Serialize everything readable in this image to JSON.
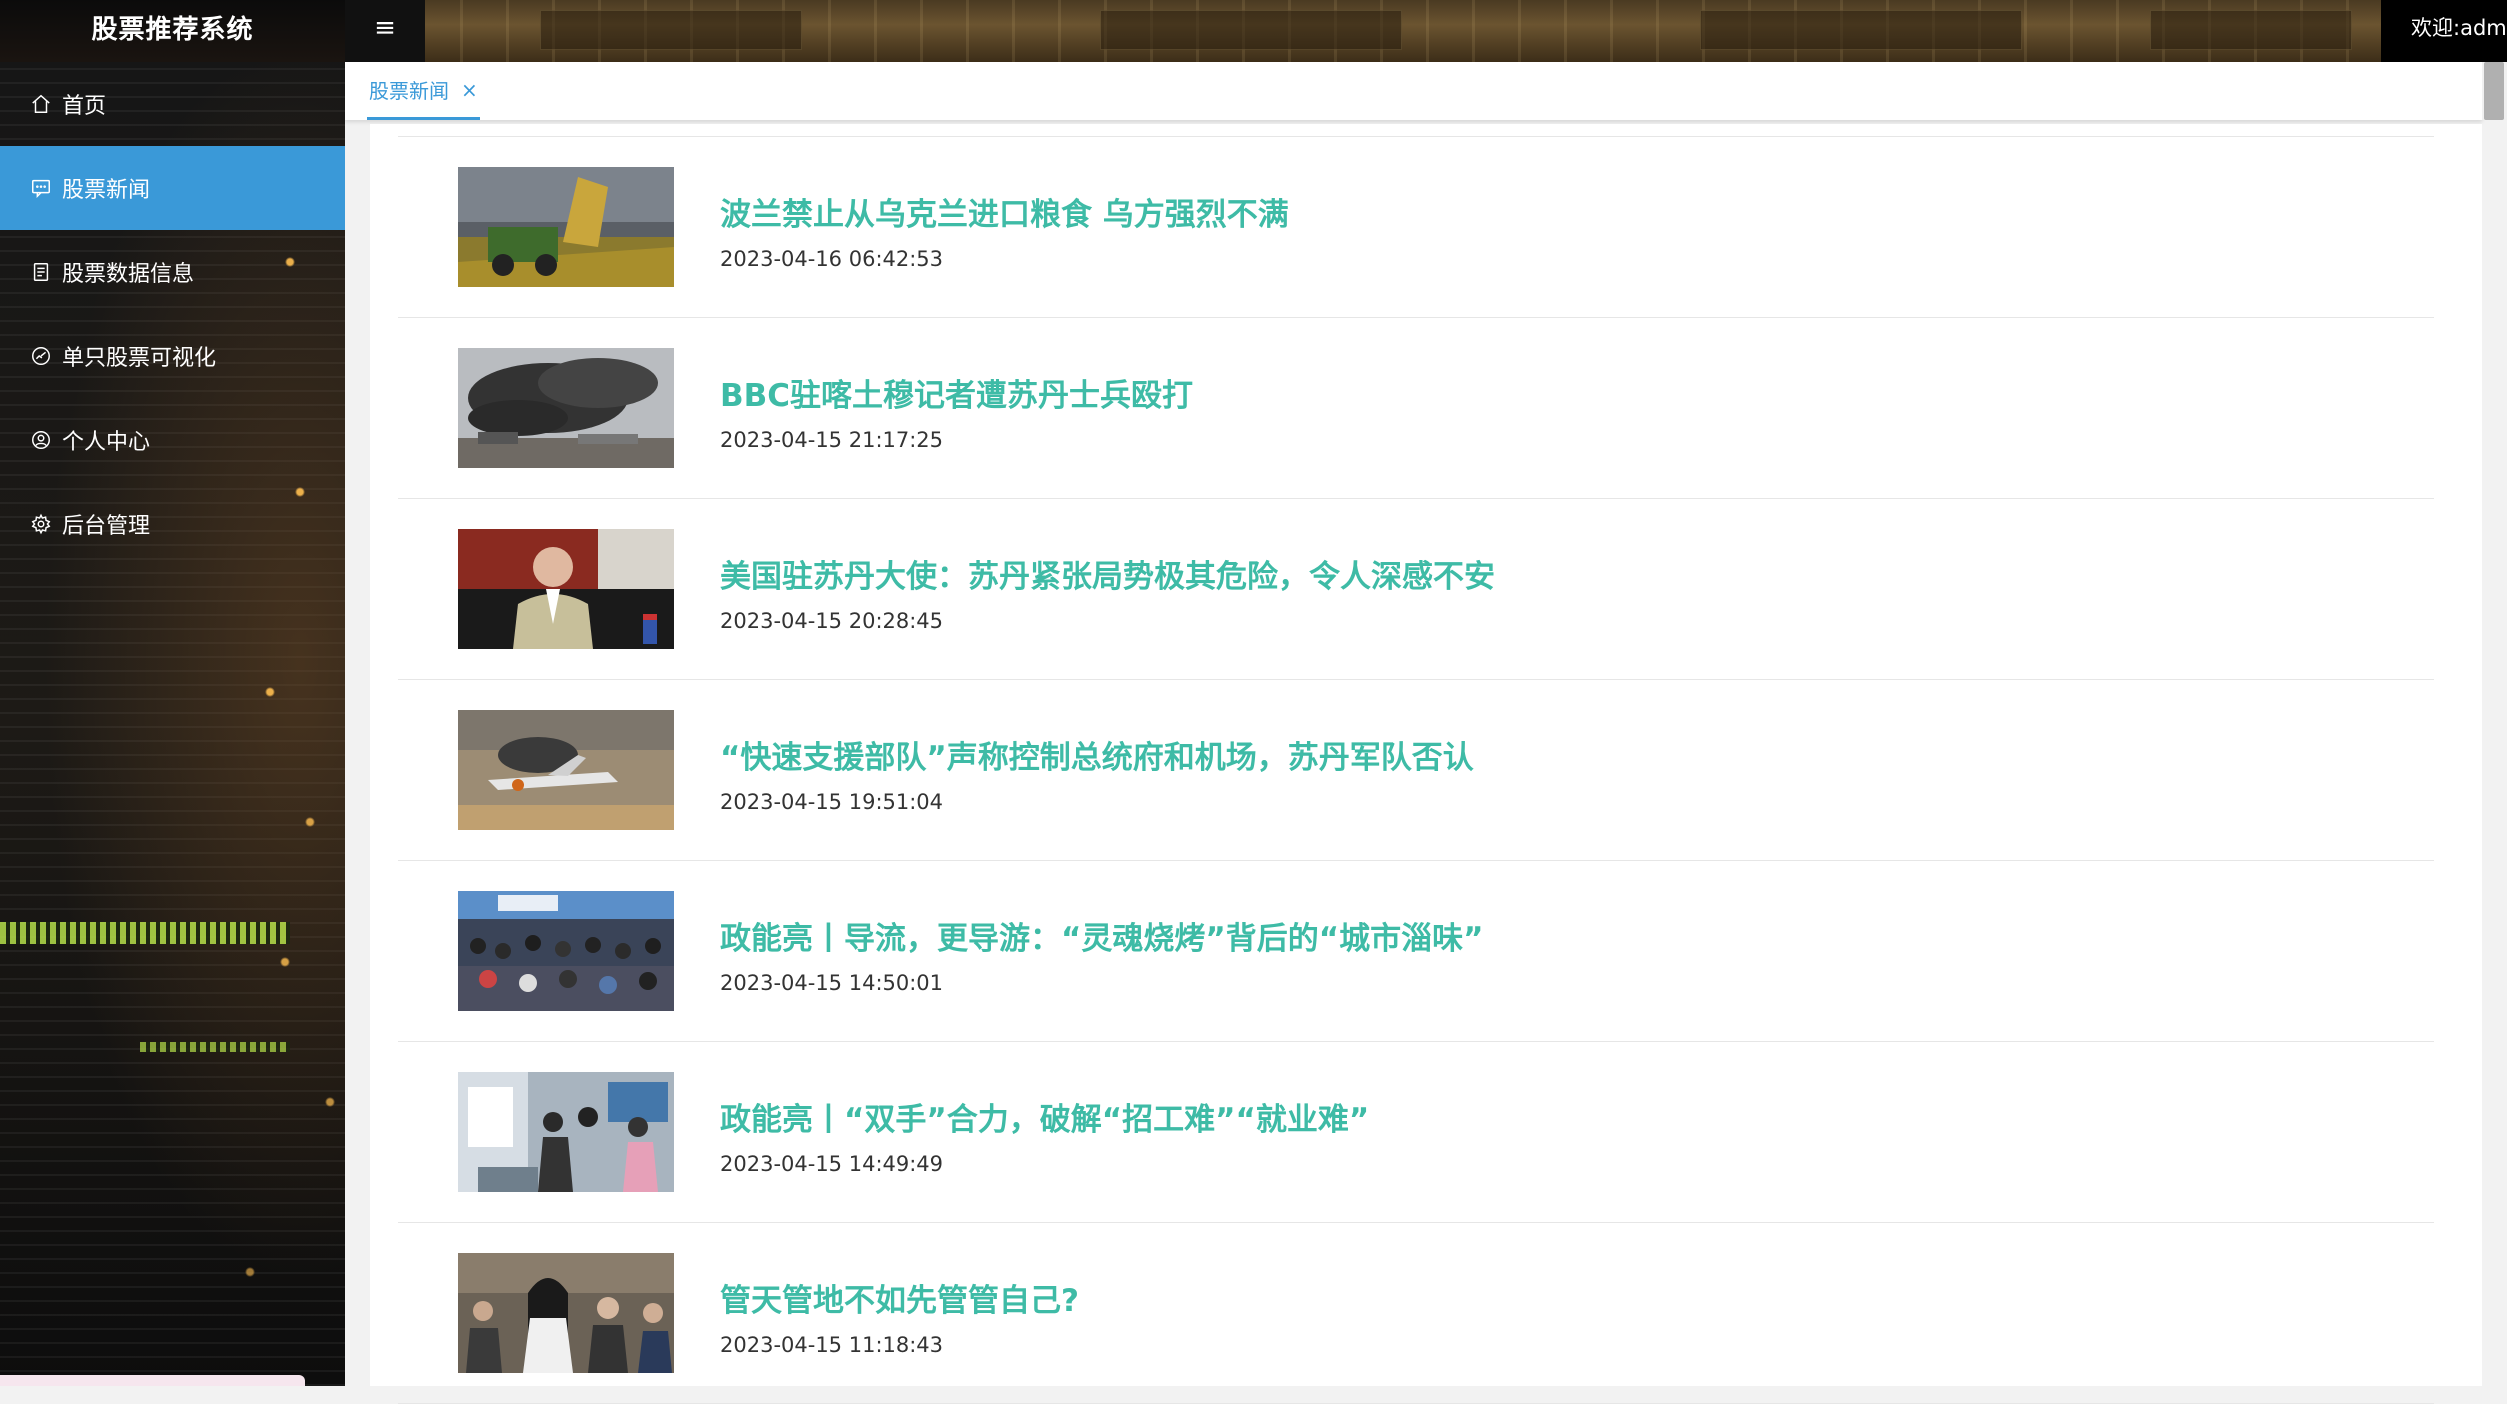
{
  "app": {
    "title": "股票推荐系统",
    "welcome": "欢迎:admin"
  },
  "sidebar": {
    "items": [
      {
        "label": "首页",
        "icon": "home-icon",
        "active": false
      },
      {
        "label": "股票新闻",
        "icon": "chat-icon",
        "active": true
      },
      {
        "label": "股票数据信息",
        "icon": "document-icon",
        "active": false
      },
      {
        "label": "单只股票可视化",
        "icon": "chart-icon",
        "active": false
      },
      {
        "label": "个人中心",
        "icon": "user-icon",
        "active": false
      },
      {
        "label": "后台管理",
        "icon": "gear-icon",
        "active": false
      }
    ]
  },
  "tabs": [
    {
      "label": "股票新闻",
      "close": "×",
      "active": true
    }
  ],
  "news": [
    {
      "title": "波兰禁止从乌克兰进口粮食 乌方强烈不满",
      "date": "2023-04-16 06:42:53",
      "image": "harvester-field-photo"
    },
    {
      "title": "BBC驻喀土穆记者遭苏丹士兵殴打",
      "date": "2023-04-15 21:17:25",
      "image": "smoke-over-city-photo"
    },
    {
      "title": "美国驻苏丹大使：苏丹紧张局势极其危险，令人深感不安",
      "date": "2023-04-15 20:28:45",
      "image": "ambassador-portrait-photo"
    },
    {
      "title": "“快速支援部队”声称控制总统府和机场，苏丹军队否认",
      "date": "2023-04-15 19:51:04",
      "image": "burning-aircraft-photo"
    },
    {
      "title": "政能亮丨导流，更导游：“灵魂烧烤”背后的“城市淄味”",
      "date": "2023-04-15 14:50:01",
      "image": "crowded-restaurant-photo"
    },
    {
      "title": "政能亮丨“双手”合力，破解“招工难”“就业难”",
      "date": "2023-04-15 14:49:49",
      "image": "job-fair-photo"
    },
    {
      "title": "管天管地不如先管管自己?",
      "date": "2023-04-15 11:18:43",
      "image": "street-crowd-photo"
    }
  ],
  "colors": {
    "accent": "#3a99d8",
    "title": "#3ebba6"
  }
}
